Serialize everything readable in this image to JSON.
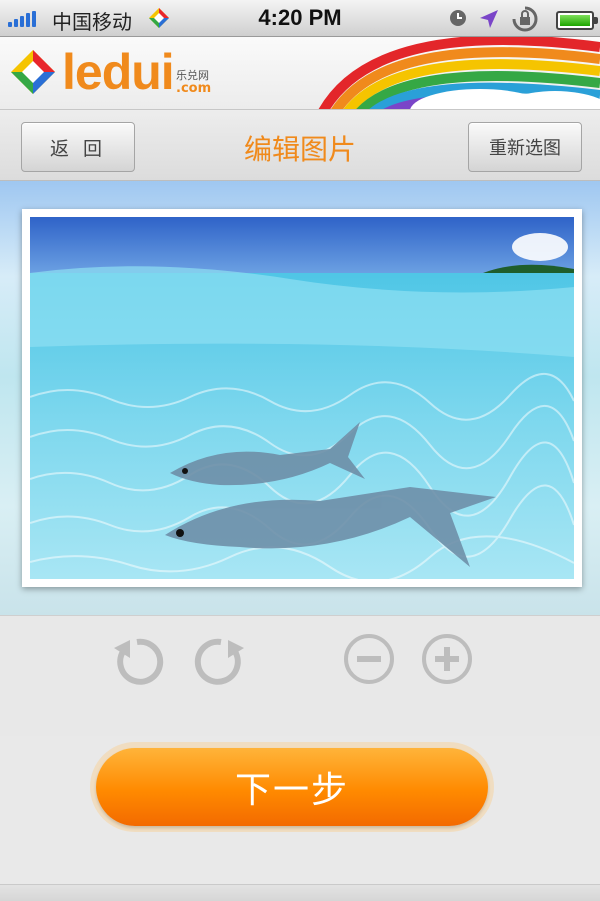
{
  "status_bar": {
    "carrier": "中国移动",
    "time": "4:20 PM",
    "signal_icon": "signal-bars-icon",
    "clock_icon": "alarm-clock-icon",
    "location_icon": "location-arrow-icon",
    "orientation_lock_icon": "rotation-lock-icon",
    "battery_icon": "battery-icon"
  },
  "brand": {
    "logo_text": "ledui",
    "logo_sub_cn": "乐兑网",
    "logo_sub_domain": ".com",
    "logo_icon": "ledui-diamond-logo"
  },
  "toolbar": {
    "back_label": "返 回",
    "title": "编辑图片",
    "reselect_label": "重新选图"
  },
  "controls": {
    "rotate_left_icon": "rotate-left-icon",
    "rotate_right_icon": "rotate-right-icon",
    "zoom_out_icon": "zoom-out-icon",
    "zoom_in_icon": "zoom-in-icon"
  },
  "next_label": "下一步",
  "colors": {
    "accent": "#f08a1c",
    "button_orange": "#ff8a00",
    "signal_blue": "#2a6fd6"
  }
}
